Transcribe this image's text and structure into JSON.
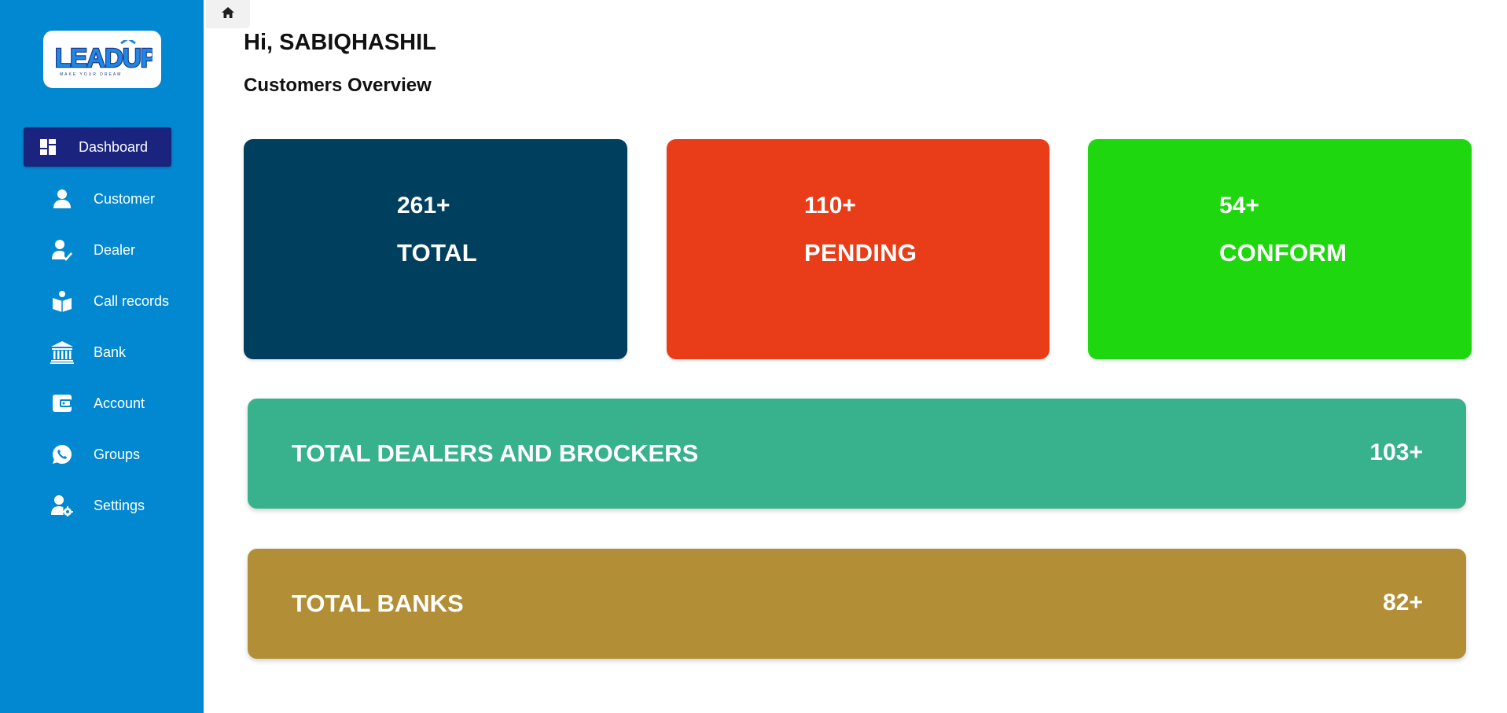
{
  "brand": {
    "logo_text": "LEADUP",
    "tagline": "MAKE YOUR DREAM"
  },
  "sidebar": {
    "items": [
      {
        "label": "Dashboard",
        "icon": "dashboard-icon",
        "active": true
      },
      {
        "label": "Customer",
        "icon": "person-icon"
      },
      {
        "label": "Dealer",
        "icon": "person-check-icon"
      },
      {
        "label": "Call records",
        "icon": "book-user-icon"
      },
      {
        "label": "Bank",
        "icon": "bank-icon"
      },
      {
        "label": "Account",
        "icon": "wallet-icon"
      },
      {
        "label": "Groups",
        "icon": "whatsapp-icon"
      },
      {
        "label": "Settings",
        "icon": "person-gear-icon"
      }
    ]
  },
  "header": {
    "greeting": "Hi, SABIQHASHIL",
    "section_title": "Customers Overview"
  },
  "stats": [
    {
      "value": "261+",
      "label": "TOTAL",
      "color": "#013f5e"
    },
    {
      "value": "110+",
      "label": "PENDING",
      "color": "#e83d18"
    },
    {
      "value": "54+",
      "label": "CONFORM",
      "color": "#1ed70f"
    }
  ],
  "summary": [
    {
      "label": "TOTAL DEALERS AND BROCKERS",
      "value": "103+",
      "color": "#38b28c"
    },
    {
      "label": "TOTAL BANKS",
      "value": "82+",
      "color": "#b28f37"
    }
  ],
  "colors": {
    "sidebar": "#0288d1",
    "active_nav": "#1a237e"
  }
}
